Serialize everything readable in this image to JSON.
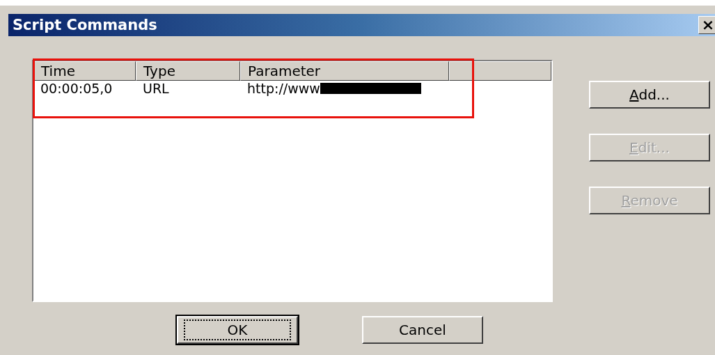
{
  "window": {
    "title": "Script Commands",
    "close": "×"
  },
  "list": {
    "columns": [
      "Time",
      "Type",
      "Parameter"
    ],
    "rows": [
      {
        "time": "00:00:05,0",
        "type": "URL",
        "parameter": "http://www",
        "redacted": true
      }
    ]
  },
  "side_buttons": [
    {
      "accel": "A",
      "rest": "dd...",
      "disabled": false
    },
    {
      "accel": "E",
      "rest": "dit...",
      "disabled": true
    },
    {
      "accel": "R",
      "rest": "emove",
      "disabled": true
    }
  ],
  "bottom_buttons": [
    {
      "label": "OK",
      "default": true
    },
    {
      "label": "Cancel",
      "default": false
    }
  ],
  "annotation": {
    "shown": true
  }
}
